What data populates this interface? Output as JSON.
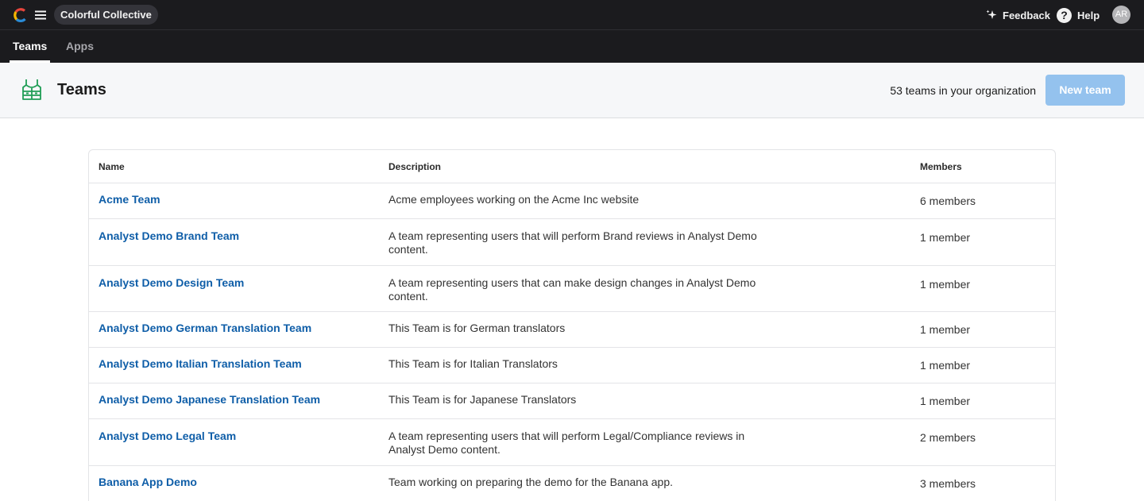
{
  "topbar": {
    "org_name": "Colorful Collective",
    "feedback_label": "Feedback",
    "help_label": "Help",
    "help_glyph": "?",
    "avatar_initials": "AR"
  },
  "tabs": [
    {
      "label": "Teams",
      "active": true
    },
    {
      "label": "Apps",
      "active": false
    }
  ],
  "header": {
    "title": "Teams",
    "count_text": "53 teams in your organization",
    "new_team_label": "New team"
  },
  "table": {
    "columns": [
      "Name",
      "Description",
      "Members"
    ],
    "rows": [
      {
        "name": "Acme Team",
        "description": "Acme employees working on the Acme Inc website",
        "members": "6 members"
      },
      {
        "name": "Analyst Demo Brand Team",
        "description": "A team representing users that will perform Brand reviews in Analyst Demo content.",
        "members": "1 member"
      },
      {
        "name": "Analyst Demo Design Team",
        "description": "A team representing users that can make design changes in Analyst Demo content.",
        "members": "1 member"
      },
      {
        "name": "Analyst Demo German Translation Team",
        "description": "This Team is for German translators",
        "members": "1 member"
      },
      {
        "name": "Analyst Demo Italian Translation Team",
        "description": "This Team is for Italian Translators",
        "members": "1 member"
      },
      {
        "name": "Analyst Demo Japanese Translation Team",
        "description": "This Team is for Japanese Translators",
        "members": "1 member"
      },
      {
        "name": "Analyst Demo Legal Team",
        "description": "A team representing users that will perform Legal/Compliance reviews in Analyst Demo content.",
        "members": "2 members"
      },
      {
        "name": "Banana App Demo",
        "description": "Team working on preparing the demo for the Banana app.",
        "members": "3 members"
      }
    ]
  },
  "colors": {
    "topbar_bg": "#1b1b1e",
    "link": "#0f5ea8",
    "primary_button_disabled": "#94c2ee",
    "team_icon": "#1f9d55"
  },
  "icons": {
    "logo": "colorful-c-logo-icon",
    "menu": "hamburger-menu-icon",
    "feedback": "sparkle-icon",
    "help": "question-circle-icon",
    "teams": "team-vest-icon"
  }
}
